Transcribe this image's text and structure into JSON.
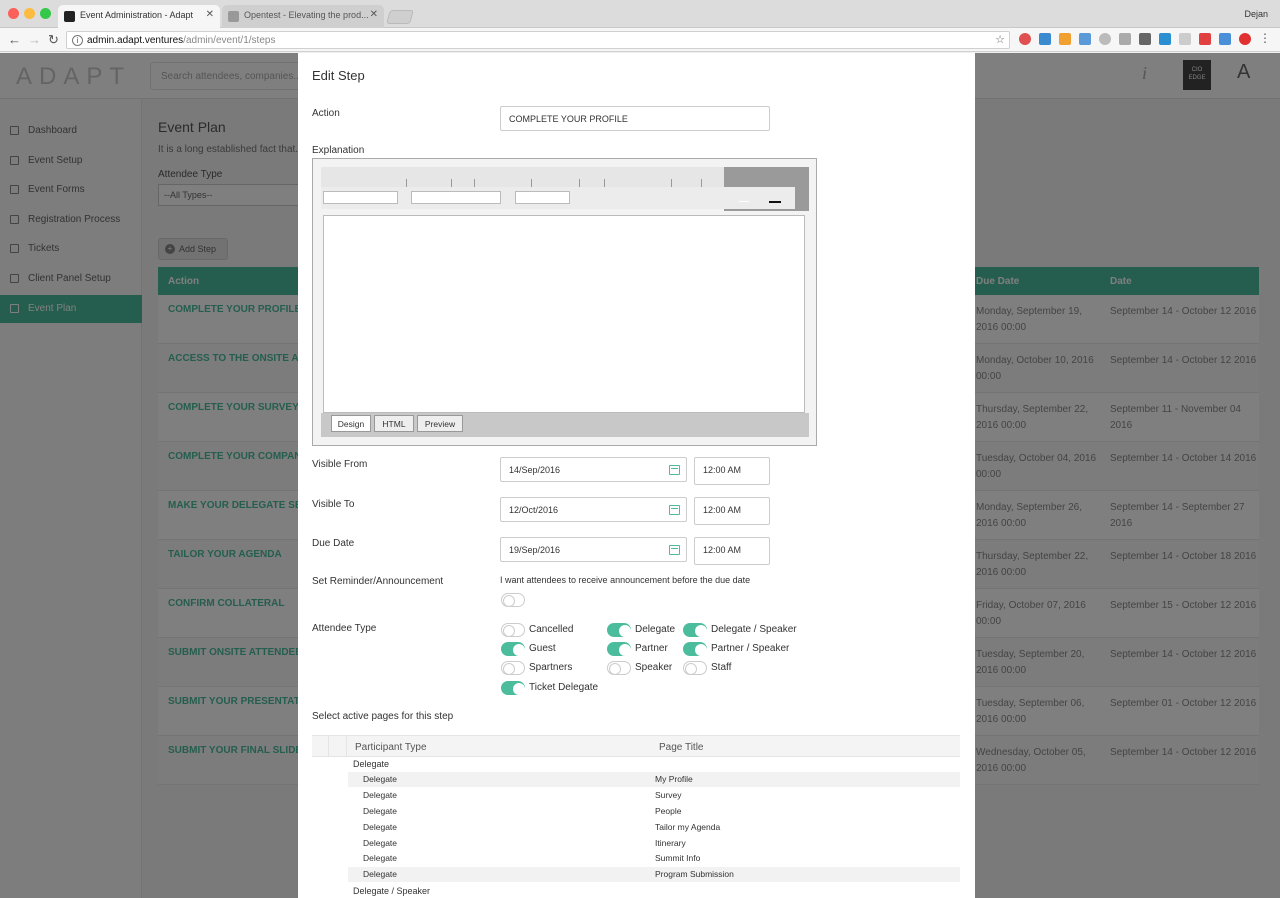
{
  "browser": {
    "tabs": [
      {
        "title": "Event Administration - Adapt"
      },
      {
        "title": "Opentest - Elevating the prod..."
      }
    ],
    "url_host": "admin.adapt.ventures",
    "url_path": "/admin/event/1/steps",
    "user": "Dejan"
  },
  "app": {
    "logo": "ADAPT",
    "search_placeholder": "Search attendees, companies...",
    "header_badge": "CIO EDGE",
    "header_avatar": "A",
    "sidebar": [
      {
        "label": "Dashboard"
      },
      {
        "label": "Event Setup"
      },
      {
        "label": "Event Forms"
      },
      {
        "label": "Registration Process"
      },
      {
        "label": "Tickets"
      },
      {
        "label": "Client Panel Setup"
      },
      {
        "label": "Event Plan"
      }
    ],
    "page_title": "Event Plan",
    "page_subtitle": "It is a long established fact that...",
    "attendee_type_label": "Attendee Type",
    "attendee_type_value": "--All Types--",
    "add_step": "Add Step",
    "columns": {
      "action": "Action",
      "due_date": "Due Date",
      "date": "Date"
    },
    "rows": [
      {
        "action": "COMPLETE YOUR PROFILE",
        "due": "Monday, September 19, 2016 00:00",
        "date": "September 14 - October 12 2016"
      },
      {
        "action": "ACCESS TO THE ONSITE APP",
        "due": "Monday, October 10, 2016 00:00",
        "date": "September 14 - October 12 2016"
      },
      {
        "action": "COMPLETE YOUR SURVEY",
        "due": "Thursday, September 22, 2016 00:00",
        "date": "September 11 - November 04 2016"
      },
      {
        "action": "COMPLETE YOUR COMPANY",
        "due": "Tuesday, October 04, 2016 00:00",
        "date": "September 14 - October 14 2016"
      },
      {
        "action": "MAKE YOUR DELEGATE SELECTION",
        "due": "Monday, September 26, 2016 00:00",
        "date": "September 14 - September 27 2016"
      },
      {
        "action": "TAILOR YOUR AGENDA",
        "due": "Thursday, September 22, 2016 00:00",
        "date": "September 14 - October 18 2016"
      },
      {
        "action": "CONFIRM COLLATERAL",
        "due": "Friday, October 07, 2016 00:00",
        "date": "September 15 - October 12 2016"
      },
      {
        "action": "SUBMIT ONSITE ATTENDEE P...",
        "due": "Tuesday, September 20, 2016 00:00",
        "date": "September 14 - October 12 2016"
      },
      {
        "action": "SUBMIT YOUR PRESENTATION",
        "due": "Tuesday, September 06, 2016 00:00",
        "date": "September 01 - October 12 2016"
      },
      {
        "action": "SUBMIT YOUR FINAL SLIDE D...",
        "due": "Wednesday, October 05, 2016 00:00",
        "date": "September 14 - October 12 2016"
      }
    ]
  },
  "modal": {
    "title": "Edit Step",
    "action_label": "Action",
    "action_value": "COMPLETE YOUR PROFILE",
    "explanation_label": "Explanation",
    "editor_tabs": [
      "Design",
      "HTML",
      "Preview"
    ],
    "visible_from_label": "Visible From",
    "visible_from_date": "14/Sep/2016",
    "visible_from_time": "12:00 AM",
    "visible_to_label": "Visible To",
    "visible_to_date": "12/Oct/2016",
    "visible_to_time": "12:00 AM",
    "due_date_label": "Due Date",
    "due_date_date": "19/Sep/2016",
    "due_date_time": "12:00 AM",
    "reminder_label": "Set Reminder/Announcement",
    "reminder_text": "I want attendees to receive announcement before the due date",
    "reminder_on": false,
    "attendee_type_label": "Attendee Type",
    "attendee_types": [
      {
        "label": "Cancelled",
        "on": false
      },
      {
        "label": "Delegate",
        "on": true
      },
      {
        "label": "Delegate / Speaker",
        "on": true
      },
      {
        "label": "Guest",
        "on": true
      },
      {
        "label": "Partner",
        "on": true
      },
      {
        "label": "Partner / Speaker",
        "on": true
      },
      {
        "label": "Spartners",
        "on": false
      },
      {
        "label": "Speaker",
        "on": false
      },
      {
        "label": "Staff",
        "on": false
      },
      {
        "label": "Ticket Delegate",
        "on": true
      }
    ],
    "pages_label": "Select active pages for this step",
    "grid_headers": {
      "participant": "Participant Type",
      "page": "Page Title"
    },
    "groups": [
      {
        "name": "Delegate",
        "rows": [
          {
            "type": "Delegate",
            "page": "My Profile"
          },
          {
            "type": "Delegate",
            "page": "Survey"
          },
          {
            "type": "Delegate",
            "page": "People"
          },
          {
            "type": "Delegate",
            "page": "Tailor my Agenda"
          },
          {
            "type": "Delegate",
            "page": "Itinerary"
          },
          {
            "type": "Delegate",
            "page": "Summit Info"
          },
          {
            "type": "Delegate",
            "page": "Program Submission"
          }
        ]
      },
      {
        "name": "Delegate / Speaker",
        "rows": []
      }
    ]
  },
  "colors": {
    "accent": "#4bbd9d",
    "overlay": "rgba(0,0,0,0.5)"
  }
}
